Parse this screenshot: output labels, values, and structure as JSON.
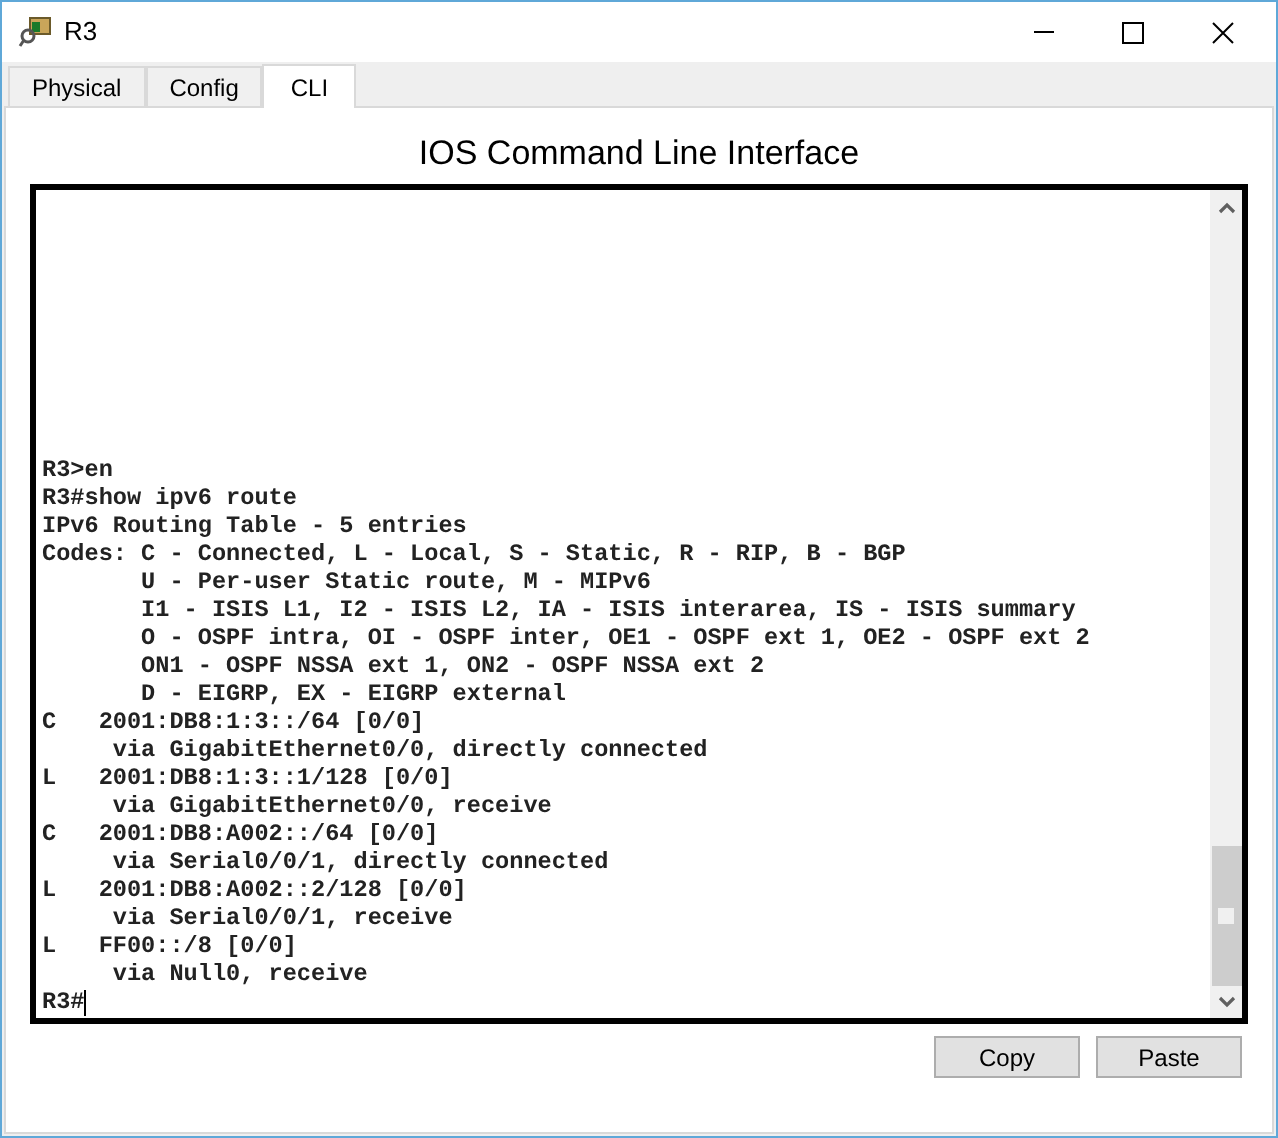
{
  "window": {
    "title": "R3"
  },
  "tabs": [
    {
      "label": "Physical",
      "selected": false
    },
    {
      "label": "Config",
      "selected": false
    },
    {
      "label": "CLI",
      "selected": true
    }
  ],
  "heading": "IOS Command Line Interface",
  "terminal": {
    "lines": [
      "R3>en",
      "R3#show ipv6 route",
      "IPv6 Routing Table - 5 entries",
      "Codes: C - Connected, L - Local, S - Static, R - RIP, B - BGP",
      "       U - Per-user Static route, M - MIPv6",
      "       I1 - ISIS L1, I2 - ISIS L2, IA - ISIS interarea, IS - ISIS summary",
      "       O - OSPF intra, OI - OSPF inter, OE1 - OSPF ext 1, OE2 - OSPF ext 2",
      "       ON1 - OSPF NSSA ext 1, ON2 - OSPF NSSA ext 2",
      "       D - EIGRP, EX - EIGRP external",
      "C   2001:DB8:1:3::/64 [0/0]",
      "     via GigabitEthernet0/0, directly connected",
      "L   2001:DB8:1:3::1/128 [0/0]",
      "     via GigabitEthernet0/0, receive",
      "C   2001:DB8:A002::/64 [0/0]",
      "     via Serial0/0/1, directly connected",
      "L   2001:DB8:A002::2/128 [0/0]",
      "     via Serial0/0/1, receive",
      "L   FF00::/8 [0/0]",
      "     via Null0, receive"
    ],
    "prompt": "R3#"
  },
  "buttons": [
    "Copy",
    "Paste"
  ]
}
